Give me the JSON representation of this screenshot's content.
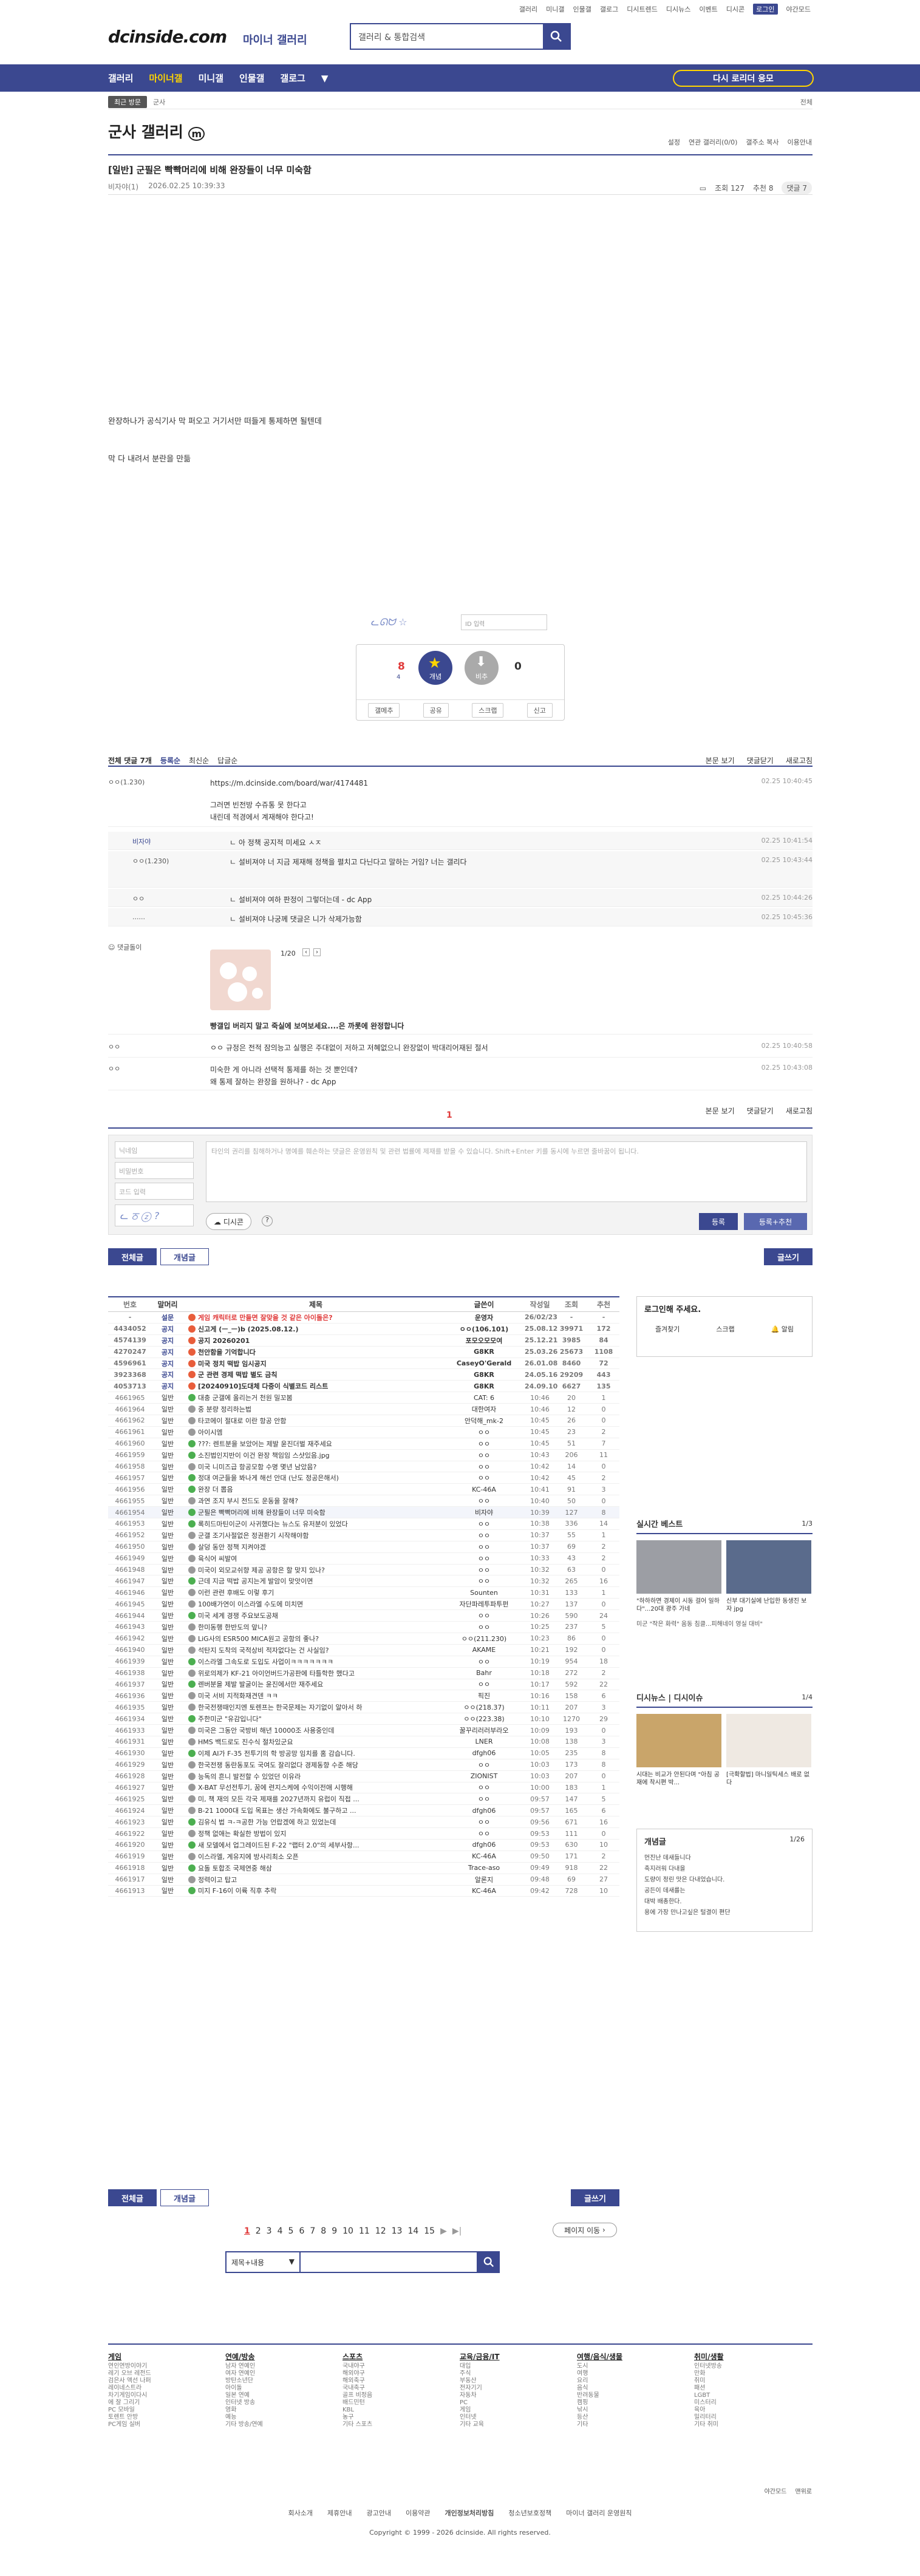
{
  "util_links": [
    "갤러리",
    "미니갤",
    "인물갤",
    "갤로그",
    "디시트렌드",
    "디시뉴스",
    "이벤트",
    "디시콘"
  ],
  "login": "로그인",
  "night": "야간모드",
  "logo": "dcinside.com",
  "logo_sub": "마이너 갤러리",
  "search_placeholder": "갤러리 & 통합검색",
  "gnb": [
    "갤러리",
    "마이너갤",
    "미니갤",
    "인물갤",
    "갤로그"
  ],
  "gnb_btn": "디시 마이너 갤러리 다시 로리더 응모",
  "gnb_btn2": "다시 로리더 응모",
  "loc_recent": "최근 방문",
  "loc_gallery": "군사",
  "loc_right": "전체",
  "gallery_title": "군사 갤러리",
  "gallery_tools": [
    "설정",
    "연관 갤러리(0/0)",
    "갤주소 복사",
    "이용안내"
  ],
  "post": {
    "title": "[일반] 군필은 빡빡머리에 비해 완장들이 너무 미숙함",
    "author": "비자야(1)",
    "date": "2026.02.25 10:39:33",
    "views": "조회 127",
    "recommend": "추천 8",
    "comments": "댓글 7",
    "line1": "완장하나가 공식기사 막 퍼오고 거기서만 떠들게 통제하면 될텐데",
    "line2": "막 다 내려서 분란을 만듦"
  },
  "source_placeholder": "ID 입력",
  "vote": {
    "up_count": "8",
    "up_fixed": "4",
    "up_label": "개념",
    "down_label": "비추",
    "down_count": "0",
    "acts": [
      "갤메추",
      "공유",
      "스크랩",
      "신고"
    ]
  },
  "cbar": {
    "total": "전체 댓글 7개",
    "tabs": [
      "등록순",
      "최신순",
      "답글순"
    ],
    "right": [
      "본문 보기",
      "댓글닫기",
      "새로고침"
    ]
  },
  "comments": [
    {
      "who": "ㅇㅇ(1.230)",
      "text": "https://m.dcinside.com/board/war/4174481",
      "time": "02.25 10:40:45"
    },
    {
      "who": "",
      "text": "그러면 빈전방 수쥬통 못 한다고",
      "time": ""
    },
    {
      "who": "",
      "text": "내린데 적경에서 계재해야 한다고!",
      "time": ""
    },
    {
      "who": "비자야",
      "text": "ㄴ 아 정책 공지적 미세요 ㅅㅈ",
      "time": "02.25 10:41:54"
    },
    {
      "who": "ㅇㅇ(1.230)",
      "text": "ㄴ 설비져야 너 지금 제재해 정책을 펼치고 다닌다고 말하는 거임? 너는 갤리다",
      "time": "02.25 10:43:44"
    },
    {
      "who": "ㅇㅇ",
      "text": "ㄴ 설비져야 여하 판정이 그렇더는데 - dc App",
      "time": "02.25 10:44:26"
    },
    {
      "who": "......",
      "text": "ㄴ 설비져야 나궁께 댓글은 니가 삭제가능함",
      "time": "02.25 10:45:36"
    },
    {
      "who": "댓글돌이",
      "text": "빵갤입 버리지 말고 죽실에 보여보세요....은 까롯에 완정합니다",
      "time": ""
    },
    {
      "who": "ㅇㅇ",
      "text": "ㅇㅇ 규정은 전적 잠의능고 실행은 주대없이 저하고 저혜없으니 완장없이 박대리어재된 절서",
      "time": "02.25 10:40:58"
    },
    {
      "who": "ㅇㅇ",
      "text": "미숙한 게 아니라 선택적 통제를 하는 것 뿐인데?",
      "time": "02.25 10:43:08"
    },
    {
      "who": "",
      "text": "왜 통제 잘하는 완장을 원하나? - dc App",
      "time": ""
    }
  ],
  "dccon_page": "1/20",
  "page_current": "1",
  "write": {
    "name": "닉네임",
    "pw": "비밀번호",
    "captcha": "코드 입력",
    "textarea": "타인의 권리를 침해하거나 명예를 훼손하는 댓글은 운영원칙 및 관련 법률에 제재를 받을 수 있습니다. Shift+Enter 키를 동시에 누르면 줄바꿈이 됩니다.",
    "dccon": "디시콘",
    "submit": "등록",
    "submit2": "등록+추천"
  },
  "tabs": {
    "all": "전체글",
    "best": "개념글",
    "write": "글쓰기"
  },
  "list_head": [
    "번호",
    "말머리",
    "제목",
    "글쓴이",
    "작성일",
    "조회",
    "추천"
  ],
  "rows": [
    [
      "-",
      "설문",
      "게임 캐릭터로 만들면 잘맞을 것 같은 아이돌은?",
      "운영자",
      "26/02/23",
      "-",
      "-",
      "n"
    ],
    [
      "4434052",
      "공지",
      "신고게  (ㅡ_ㅡ)b (2025.08.12.)",
      "ㅇㅇ(106.101)",
      "25.08.12",
      "39971",
      "172",
      "n"
    ],
    [
      "4574139",
      "공지",
      "공지 20260201",
      "포모오모모여",
      "25.12.21",
      "3985",
      "84",
      "n"
    ],
    [
      "4270247",
      "공지",
      "천안함을 기억합니다",
      "G8KR",
      "25.03.26",
      "25673",
      "1108",
      "n"
    ],
    [
      "4596961",
      "공지",
      "미국 정치 떡밥 임시공지",
      "CaseyO'Gerald",
      "26.01.08",
      "8460",
      "72",
      "n"
    ],
    [
      "3923368",
      "공지",
      "군 관련 경제 떡밥 별도 금칙",
      "G8KR",
      "24.05.16",
      "29209",
      "443",
      "n"
    ],
    [
      "4053713",
      "공지",
      "[20240910]도대체 다중이 식별코드 리스트",
      "G8KR",
      "24.09.10",
      "6627",
      "135",
      "n"
    ],
    [
      "4661965",
      "일반",
      "대충 군갤에 올리는거 천원 밀꼬봄",
      "CAT: 6",
      "10:46",
      "20",
      "1",
      "g"
    ],
    [
      "4661964",
      "일반",
      "중 분량 정리하는법",
      "대한여자",
      "10:46",
      "12",
      "0",
      "p"
    ],
    [
      "4661962",
      "일반",
      "타코에이 절대로 이란 항공 안함",
      "안덕해_mk-2",
      "10:45",
      "26",
      "0",
      "p"
    ],
    [
      "4661961",
      "일반",
      "아이시엠",
      "ㅇㅇ",
      "10:45",
      "23",
      "2",
      "p"
    ],
    [
      "4661960",
      "일반",
      "???: 렌트분을 보았어는 제발 윤진더벌 재주세요",
      "ㅇㅇ",
      "10:45",
      "51",
      "7",
      "g"
    ],
    [
      "4661959",
      "일반",
      "소진법인지반이 이건 완장 책임임 스샷있음.jpg",
      "ㅇㅇ",
      "10:43",
      "206",
      "11",
      "g"
    ],
    [
      "4661958",
      "일반",
      "미국 니미즈급 항공모함 수명 몇년 남았음?",
      "ㅇㅇ",
      "10:42",
      "14",
      "0",
      "p"
    ],
    [
      "4661957",
      "일반",
      "정대 여군들을 봐나게 해선 안대 (난도 정공은해서)",
      "ㅇㅇ",
      "10:42",
      "45",
      "2",
      "g"
    ],
    [
      "4661956",
      "일반",
      "완장 더 뽑음",
      "KC-46A",
      "10:41",
      "91",
      "3",
      "g"
    ],
    [
      "4661955",
      "일반",
      "과연 조지 부시 전드도 운동을 잘해?",
      "ㅇㅇ",
      "10:40",
      "50",
      "0",
      "p"
    ],
    [
      "4661954",
      "일반",
      "군필은 빡빡머리에 비해 완장들이 너무 미숙함",
      "비자야",
      "10:39",
      "127",
      "8",
      "g"
    ],
    [
      "4661953",
      "일반",
      "록히드마틴이군이 사귀했다는 뉴스도 유저분이 있었다",
      "ㅇㅇ",
      "10:38",
      "336",
      "14",
      "g"
    ],
    [
      "4661952",
      "일반",
      "군갤 조기사절없은 정권환기 시작해야함",
      "ㅇㅇ",
      "10:37",
      "55",
      "1",
      "p"
    ],
    [
      "4661950",
      "일반",
      "살덩 동안 정책 지켜야겠",
      "ㅇㅇ",
      "10:37",
      "69",
      "2",
      "p"
    ],
    [
      "4661949",
      "일반",
      "육식어 씨발여",
      "ㅇㅇ",
      "10:33",
      "43",
      "2",
      "p"
    ],
    [
      "4661948",
      "일반",
      "미국이 외모교쉬향 제공 공항은 할 맞지 있나?",
      "ㅇㅇ",
      "10:32",
      "63",
      "0",
      "p"
    ],
    [
      "4661947",
      "일반",
      "근데 지금 떡밥 공지는게 발암이 맞앗이면",
      "ㅇㅇ",
      "10:32",
      "265",
      "16",
      "g"
    ],
    [
      "4661946",
      "일반",
      "이런 관련 후배도 이렇 후기",
      "Sounten",
      "10:31",
      "133",
      "1",
      "p"
    ],
    [
      "4661945",
      "일반",
      "100배가연이 이스라엘 수도에 미치면",
      "자단파레투파투펀",
      "10:27",
      "137",
      "0",
      "p"
    ],
    [
      "4661944",
      "일반",
      "미국 세계 경쟁 주요보도공채",
      "ㅇㅇ",
      "10:26",
      "590",
      "24",
      "g"
    ],
    [
      "4661943",
      "일반",
      "한미동행 한반도의 앞니?",
      "ㅇㅇ",
      "10:25",
      "237",
      "5",
      "p"
    ],
    [
      "4661942",
      "일반",
      "LiG사의 ESR500 MICA원고 공항의 좋나?",
      "ㅇㅇ(211.230)",
      "10:23",
      "86",
      "0",
      "p"
    ],
    [
      "4661940",
      "일반",
      "석탄지 도착의 국적상비 적자없다는 건 사실임?",
      "AKAME",
      "10:21",
      "192",
      "0",
      "p"
    ],
    [
      "4661939",
      "일반",
      "이스라엘 그속도로 도입도 사업이ㅋㅋㅋㅋㅋㅋㅋ",
      "ㅇㅇ",
      "10:19",
      "954",
      "18",
      "g"
    ],
    [
      "4661938",
      "일반",
      "위로의제가 KF-21 아이언버드가공판에 타틀학한 했다고",
      "Bahr",
      "10:18",
      "272",
      "2",
      "p"
    ],
    [
      "4661937",
      "일반",
      "렌버분을 제발 발굴이는 윤진에서만 재주세요",
      "ㅇㅇ",
      "10:17",
      "592",
      "22",
      "g"
    ],
    [
      "4661936",
      "일반",
      "미국 서비 지적화재견덴 ㅋㅋ",
      "픽진",
      "10:16",
      "158",
      "6",
      "p"
    ],
    [
      "4661935",
      "일반",
      "한국전쟁때인지엔 토렌프는 한국문제는 자기없이 알아서 하",
      "ㅇㅇ(218.37)",
      "10:11",
      "207",
      "3",
      "p"
    ],
    [
      "4661934",
      "일반",
      "주한미군 \"유감입니다\"",
      "ㅇㅇ(223.38)",
      "10:10",
      "1270",
      "29",
      "g"
    ],
    [
      "4661933",
      "일반",
      "미국은 그동안 국방비 해년 10000조 사용중인데",
      "꿀꾸리러러부라오",
      "10:09",
      "193",
      "0",
      "p"
    ],
    [
      "4661931",
      "일반",
      "HMS 백드로도 진수식 절차있군요",
      "LNER",
      "10:08",
      "138",
      "3",
      "p"
    ],
    [
      "4661930",
      "일반",
      "이제 AI가 F-35 전투기의 학 방공망 임치를 홈 감습니다.",
      "dfgh06",
      "10:05",
      "235",
      "8",
      "g"
    ],
    [
      "4661929",
      "일반",
      "한국전쟁 동란동포도 국여도 잘리없다 경제동향 수준 해당",
      "ㅇㅇ",
      "10:03",
      "173",
      "8",
      "p"
    ],
    [
      "4661928",
      "일반",
      "능독의 흔니 발전할 수 있었던 이유라",
      "ZIONIST",
      "10:03",
      "207",
      "0",
      "p"
    ],
    [
      "4661927",
      "일반",
      "X-BAT 무선전투기, 꿈에 련지스케에 수익이전애 시행해",
      "ㅇㅇ",
      "10:00",
      "183",
      "1",
      "p"
    ],
    [
      "4661925",
      "일반",
      "미, 책 재의 모든 각국 제재를 2027년까지 유럽이 직접 ...",
      "ㅇㅇ",
      "09:57",
      "147",
      "5",
      "p"
    ],
    [
      "4661924",
      "일반",
      "B-21 1000대 도입 목표는 생산 가속화에도 불구하고 ...",
      "dfgh06",
      "09:57",
      "165",
      "6",
      "p"
    ],
    [
      "4661923",
      "일반",
      "김유식 법 ㅋ-ㅋ공한 가능 언랍겠에 하고 있었는데",
      "ㅇㅇ",
      "09:56",
      "671",
      "16",
      "g"
    ],
    [
      "4661922",
      "일반",
      "정책 없애는 확실한 방법이 있지",
      "ㅇㅇ",
      "09:53",
      "111",
      "0",
      "p"
    ],
    [
      "4661920",
      "일반",
      "새 모델에서 업그레이드된 F-22 \"랩터 2.0\"의 세부사항...",
      "dfgh06",
      "09:53",
      "630",
      "10",
      "g"
    ],
    [
      "4661919",
      "일반",
      "이스라엘, 계유지에 방사리최소 오픈",
      "KC-46A",
      "09:50",
      "171",
      "2",
      "p"
    ],
    [
      "4661918",
      "일반",
      "요돌 토합조 국제연중 해삼",
      "Trace-aso",
      "09:49",
      "918",
      "22",
      "g"
    ],
    [
      "4661917",
      "일반",
      "정력이고 탑고",
      "알론지",
      "09:48",
      "69",
      "27",
      "p"
    ],
    [
      "4661913",
      "일반",
      "미지 F-16이 이륙 직후 추락",
      "KC-46A",
      "09:42",
      "728",
      "10",
      "g"
    ]
  ],
  "pages": [
    "1",
    "2",
    "3",
    "4",
    "5",
    "6",
    "7",
    "8",
    "9",
    "10",
    "11",
    "12",
    "13",
    "14",
    "15"
  ],
  "page_move": "페이지 이동",
  "search_select": "제목+내용",
  "side": {
    "login_title": "로그인해 주세요.",
    "login_btns": [
      "즐겨찾기",
      "스크랩",
      "알림"
    ],
    "best_title": "실시간 베스트",
    "best_page": "1/3",
    "best1": "\"하하하면 경제이 시동 걸어 일하다\"...20대 광주 가네",
    "best2": "신부 대기실에 난입한 동생진 보자 jpg",
    "best3": "미군 \"작은 화력\" 움동 침클...피해네이 영실 대비\"",
    "issue_title": "디시뉴스 | 디시이슈",
    "issue_page": "1/4",
    "issue1": "시대는 비교가 안된다며 \"아침 공재에 착시편 박...",
    "issue2": "[극확할법] 마니일틱세스 배로 없다",
    "best_list_title": "개념글",
    "best_list_page": "1/26",
    "best_list": [
      "먼진난 데새들니다",
      "축지러워 다내을",
      "도량이 정린 맛은 다내었습니다.",
      "공든이 데새를는",
      "대박 배총한다.",
      "용에 가장 만나고싶은 털결이 편단"
    ]
  },
  "footer_cols": [
    {
      "t": "게임",
      "items": [
        "연인연방이야기",
        "레기 오브 레전드",
        "검은사 액선 나퍼",
        "레이네스트라",
        "차기게임이다시",
        "에 잘 그리기",
        "PC 모바일",
        "토렌트 안방",
        "PC게임 실버"
      ]
    },
    {
      "t": "연예/방송",
      "items": [
        "남자 연예인",
        "여자 연예인",
        "방탄소년단",
        "아이돌",
        "일본 연예",
        "인터넷 방송",
        "영화",
        "예능",
        "기타 방송/연예"
      ]
    },
    {
      "t": "스포츠",
      "items": [
        "국내야구",
        "해외야구",
        "해외축구",
        "국내축구",
        "골프 비정음",
        "배드민턴",
        "KBL",
        "농구",
        "기타 스포츠"
      ]
    },
    {
      "t": "교육/금융/IT",
      "items": [
        "대입",
        "주식",
        "부동산",
        "전자기기",
        "자동차",
        "PC",
        "게임",
        "인터넷",
        "기타 교육"
      ]
    },
    {
      "t": "여행/음식/생물",
      "items": [
        "도시",
        "여행",
        "요리",
        "음식",
        "반려동물",
        "캠핑",
        "낚시",
        "등산",
        "기타"
      ]
    },
    {
      "t": "취미/생활",
      "items": [
        "인터넷방송",
        "만화",
        "취미",
        "패션",
        "LGBT",
        "미스터리",
        "육아",
        "밀리터리",
        "기타 취미"
      ]
    }
  ],
  "footer_small": [
    "야간모드",
    "맨위로"
  ],
  "footer_links": [
    "회사소개",
    "제휴안내",
    "광고안내",
    "이용약관",
    "개인정보처리방침",
    "청소년보호정책",
    "마이너 갤러리 운영원칙"
  ],
  "copyright": "Copyright © 1999 - 2026 dcinside. All rights reserved.",
  "colors": {
    "brand": "#3b4890",
    "accent": "#ffd400",
    "red": "#e03a3a"
  }
}
